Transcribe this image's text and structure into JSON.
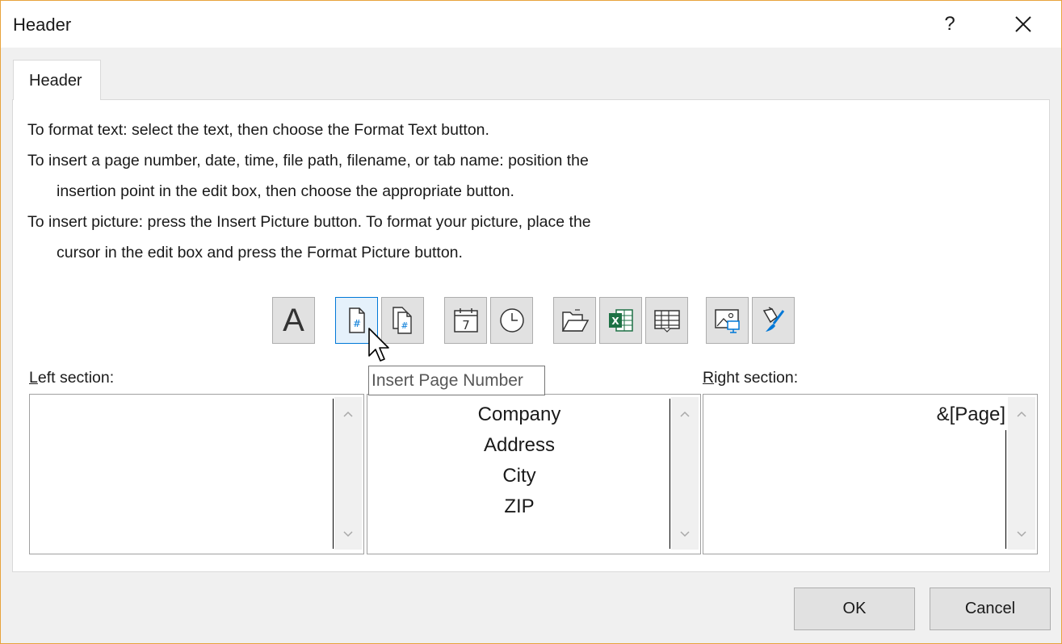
{
  "window": {
    "title": "Header",
    "help_label": "?",
    "close_label": "✕"
  },
  "tab": {
    "label": "Header"
  },
  "instructions": [
    "To format text:  select the text, then choose the Format Text button.",
    "To insert a page number, date, time, file path, filename, or tab name:  position the",
    "insertion point in the edit box, then choose the appropriate button.",
    "To insert picture: press the Insert Picture button.  To format your picture, place the",
    "cursor in the edit box and press the Format Picture button."
  ],
  "toolbar": {
    "format_text_icon": "A",
    "buttons": [
      "format-text-icon",
      "page-number-icon",
      "number-of-pages-icon",
      "date-icon",
      "time-icon",
      "file-path-icon",
      "filename-icon",
      "sheet-name-icon",
      "insert-picture-icon",
      "format-picture-icon"
    ],
    "active": "page-number-icon",
    "date_icon_digit": "7"
  },
  "sections": {
    "left": {
      "label_key": "L",
      "label_rest": "eft section:",
      "lines": []
    },
    "center": {
      "lines": [
        "Company",
        "Address",
        "City",
        "ZIP"
      ]
    },
    "right": {
      "label_key": "R",
      "label_rest": "ight section:",
      "lines": [
        "&[Page]"
      ]
    }
  },
  "tooltip": {
    "text": "Insert Page Number"
  },
  "buttons": {
    "ok": "OK",
    "cancel": "Cancel"
  },
  "colors": {
    "accent": "#0078d7",
    "window_border": "#e8a33d",
    "excel_green": "#1e7145"
  }
}
